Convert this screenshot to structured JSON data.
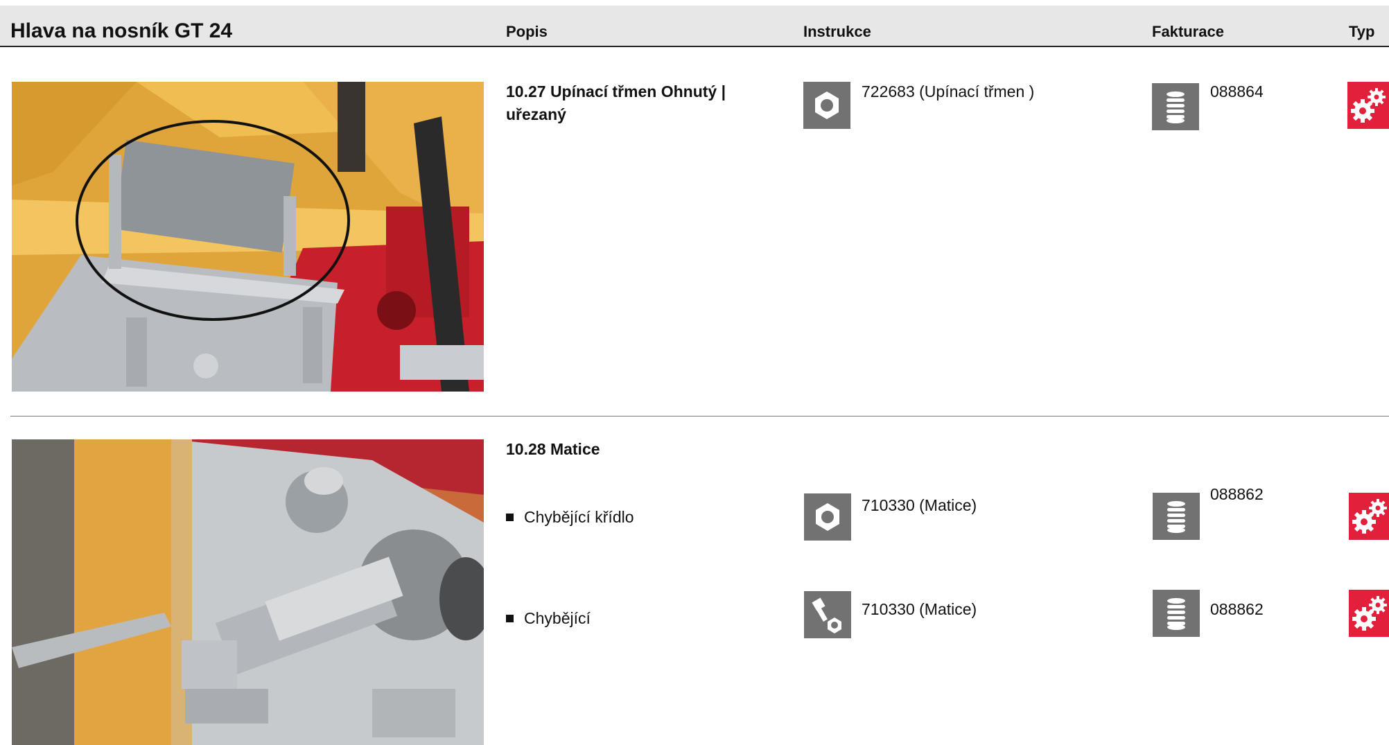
{
  "header": {
    "title": "Hlava na nosník GT 24",
    "col_popis": "Popis",
    "col_instrukce": "Instrukce",
    "col_fakturace": "Fakturace",
    "col_typ": "Typ"
  },
  "items": [
    {
      "title_line1": "10.27 Upínací třmen  Ohnutý |",
      "title_line2": "uřezaný",
      "instruction": "722683 (Upínací třmen )",
      "instruction_icon": "nut-icon",
      "billing": "088864",
      "billing_icon": "coil-stack-icon",
      "type_icon": "gears-icon"
    },
    {
      "title": "10.28 Matice",
      "rows": [
        {
          "label": "Chybějící křídlo",
          "instruction": "710330 (Matice)",
          "instruction_icon": "nut-icon",
          "billing": "088862",
          "billing_icon": "coil-stack-icon",
          "type_icon": "gears-icon"
        },
        {
          "label": "Chybějící",
          "instruction": "710330 (Matice)",
          "instruction_icon": "bolt-nut-icon",
          "billing": "088862",
          "billing_icon": "coil-stack-icon",
          "type_icon": "gears-icon"
        }
      ]
    }
  ],
  "colors": {
    "header_bg": "#e7e7e7",
    "icon_gray": "#727272",
    "type_red": "#e3203b"
  }
}
